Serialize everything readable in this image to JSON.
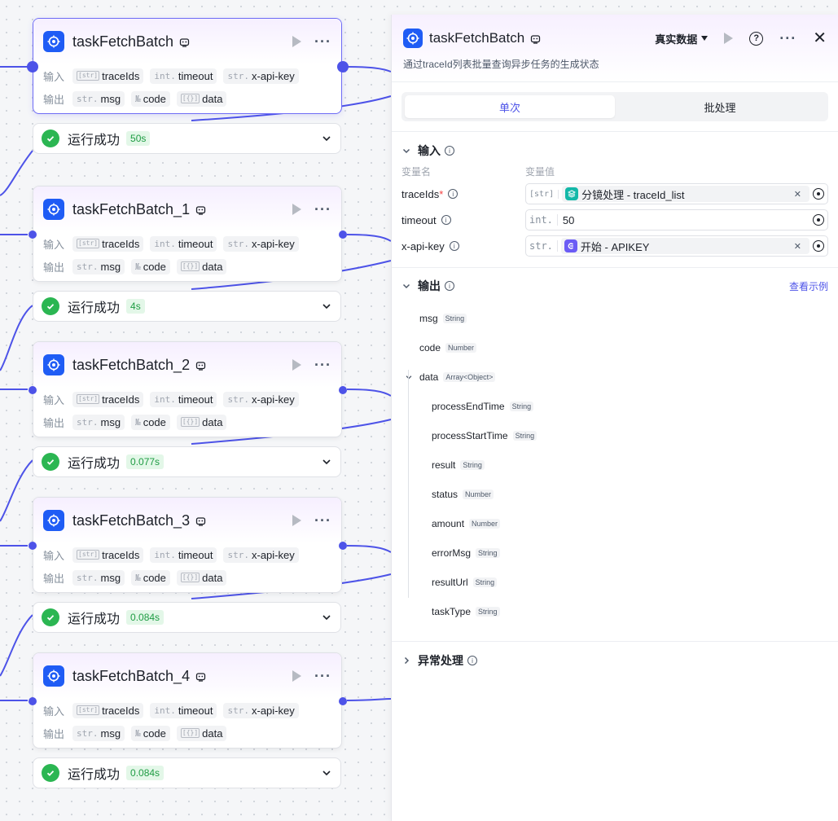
{
  "nodes": [
    {
      "title": "taskFetchBatch",
      "status": "运行成功",
      "time": "50s"
    },
    {
      "title": "taskFetchBatch_1",
      "status": "运行成功",
      "time": "4s"
    },
    {
      "title": "taskFetchBatch_2",
      "status": "运行成功",
      "time": "0.077s"
    },
    {
      "title": "taskFetchBatch_3",
      "status": "运行成功",
      "time": "0.084s"
    },
    {
      "title": "taskFetchBatch_4",
      "status": "运行成功",
      "time": "0.084s"
    }
  ],
  "node_rows": {
    "input_label": "输入",
    "output_label": "输出",
    "inputs": [
      {
        "type": "[str]",
        "name": "traceIds"
      },
      {
        "type": "int.",
        "name": "timeout"
      },
      {
        "type": "str.",
        "name": "x-api-key"
      }
    ],
    "outputs": [
      {
        "type": "str.",
        "name": "msg"
      },
      {
        "type": "№",
        "name": "code"
      },
      {
        "type": "[{}]",
        "name": "data"
      }
    ]
  },
  "panel": {
    "title": "taskFetchBatch",
    "mode": "真实数据",
    "description": "通过traceId列表批量查询异步任务的生成状态",
    "tabs": [
      "单次",
      "批处理"
    ],
    "input_section": {
      "title": "输入",
      "col_name": "变量名",
      "col_value": "变量值",
      "rows": [
        {
          "name": "traceIds",
          "required": "*",
          "type": "[str]",
          "ref_node": "分镜处理",
          "ref_var": "traceId_list",
          "ref_full": "分镜处理 - traceId_list"
        },
        {
          "name": "timeout",
          "required": "",
          "type": "int.",
          "value": "50"
        },
        {
          "name": "x-api-key",
          "required": "",
          "type": "str.",
          "ref_node": "开始",
          "ref_var": "APIKEY",
          "ref_full": "开始 - APIKEY"
        }
      ]
    },
    "output_section": {
      "title": "输出",
      "link": "查看示例",
      "fields": [
        {
          "name": "msg",
          "type": "String"
        },
        {
          "name": "code",
          "type": "Number"
        },
        {
          "name": "data",
          "type": "Array<Object>"
        }
      ],
      "children": [
        {
          "name": "processEndTime",
          "type": "String"
        },
        {
          "name": "processStartTime",
          "type": "String"
        },
        {
          "name": "result",
          "type": "String"
        },
        {
          "name": "status",
          "type": "Number"
        },
        {
          "name": "amount",
          "type": "Number"
        },
        {
          "name": "errorMsg",
          "type": "String"
        },
        {
          "name": "resultUrl",
          "type": "String"
        },
        {
          "name": "taskType",
          "type": "String"
        }
      ]
    },
    "error_section": {
      "title": "异常处理"
    }
  },
  "colors": {
    "accent": "#4d53e8",
    "node_icon": "#1f5cf5",
    "success": "#2bb652"
  }
}
